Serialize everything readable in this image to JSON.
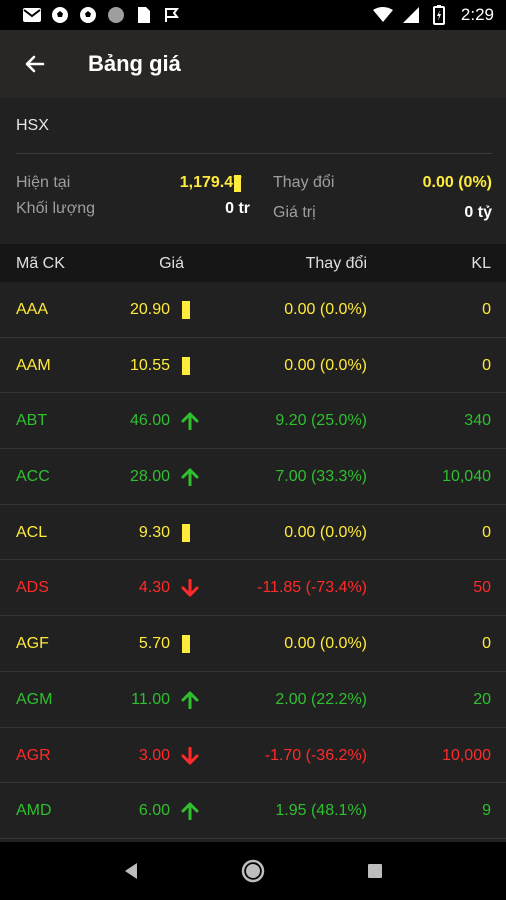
{
  "status_bar": {
    "time": "2:29",
    "left_icons": [
      "gmail-icon",
      "soccer-ball-icon",
      "soccer-ball-icon",
      "circle-icon",
      "sim-card-icon",
      "flag-icon"
    ],
    "right_icons": [
      "wifi-icon",
      "signal-icon",
      "battery-icon"
    ]
  },
  "app_bar": {
    "title": "Bảng giá",
    "back_icon": "arrow-back-icon"
  },
  "exchange": {
    "name": "HSX"
  },
  "summary": {
    "current_label": "Hiện tại",
    "current_value": "1,179.47",
    "change_label": "Thay đổi",
    "change_value": "0.00 (0%)",
    "volume_label": "Khối lượng",
    "volume_value": "0 tr",
    "value_label": "Giá trị",
    "value_value": "0 tỷ"
  },
  "table": {
    "headers": {
      "symbol": "Mã CK",
      "price": "Giá",
      "change": "Thay đổi",
      "volume": "KL"
    },
    "rows": [
      {
        "symbol": "AAA",
        "price": "20.90",
        "change": "0.00 (0.0%)",
        "volume": "0",
        "status": "ref"
      },
      {
        "symbol": "AAM",
        "price": "10.55",
        "change": "0.00 (0.0%)",
        "volume": "0",
        "status": "ref"
      },
      {
        "symbol": "ABT",
        "price": "46.00",
        "change": "9.20 (25.0%)",
        "volume": "340",
        "status": "up"
      },
      {
        "symbol": "ACC",
        "price": "28.00",
        "change": "7.00 (33.3%)",
        "volume": "10,040",
        "status": "up"
      },
      {
        "symbol": "ACL",
        "price": "9.30",
        "change": "0.00 (0.0%)",
        "volume": "0",
        "status": "ref"
      },
      {
        "symbol": "ADS",
        "price": "4.30",
        "change": "-11.85 (-73.4%)",
        "volume": "50",
        "status": "down"
      },
      {
        "symbol": "AGF",
        "price": "5.70",
        "change": "0.00 (0.0%)",
        "volume": "0",
        "status": "ref"
      },
      {
        "symbol": "AGM",
        "price": "11.00",
        "change": "2.00 (22.2%)",
        "volume": "20",
        "status": "up"
      },
      {
        "symbol": "AGR",
        "price": "3.00",
        "change": "-1.70 (-36.2%)",
        "volume": "10,000",
        "status": "down"
      },
      {
        "symbol": "AMD",
        "price": "6.00",
        "change": "1.95 (48.1%)",
        "volume": "9",
        "status": "up"
      }
    ]
  },
  "colors": {
    "ref": "#ffeb3b",
    "up": "#2fbf2f",
    "down": "#ff2a2a",
    "background": "#212121",
    "app_bar": "#292624"
  },
  "nav_bar": {
    "icons": [
      "back-triangle-icon",
      "home-circle-icon",
      "recents-square-icon"
    ]
  }
}
